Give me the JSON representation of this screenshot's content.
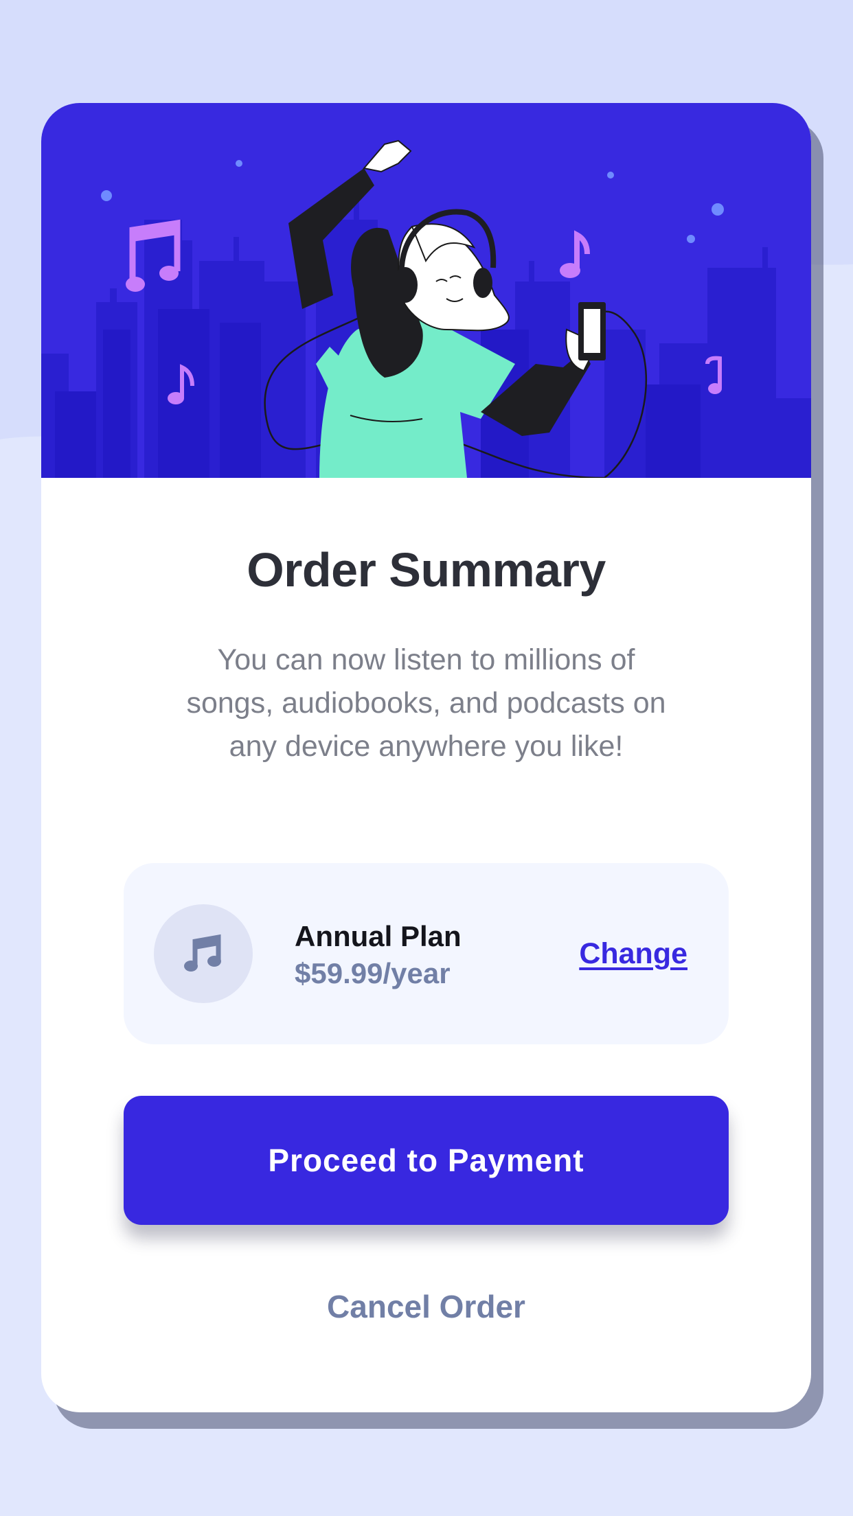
{
  "order_summary": {
    "title": "Order Summary",
    "description": "You can now listen to millions of songs, audiobooks, and podcasts on any device anywhere you like!",
    "plan": {
      "icon": "music-note-icon",
      "name": "Annual Plan",
      "price": "$59.99/year",
      "change_label": "Change"
    },
    "primary_action": "Proceed to Payment",
    "secondary_action": "Cancel Order"
  },
  "colors": {
    "page_background": "#e1e7fd",
    "hero_background": "#3829e0",
    "accent": "#3828e0",
    "muted_text": "#717fa6",
    "plan_box": "#f3f6ff"
  }
}
